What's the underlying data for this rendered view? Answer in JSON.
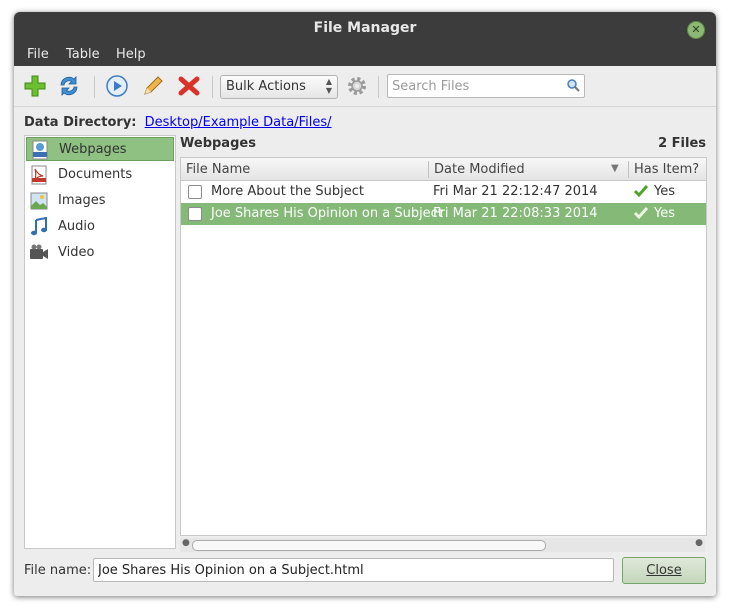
{
  "window": {
    "title": "File Manager"
  },
  "menu": [
    "File",
    "Table",
    "Help"
  ],
  "toolbar": {
    "bulk_actions": "Bulk Actions",
    "search_placeholder": "Search Files"
  },
  "data_directory": {
    "label": "Data Directory:",
    "path": "Desktop/Example Data/Files/"
  },
  "sidebar": {
    "items": [
      {
        "label": "Webpages",
        "icon": "html-file-icon",
        "selected": true
      },
      {
        "label": "Documents",
        "icon": "pdf-file-icon",
        "selected": false
      },
      {
        "label": "Images",
        "icon": "image-file-icon",
        "selected": false
      },
      {
        "label": "Audio",
        "icon": "music-note-icon",
        "selected": false
      },
      {
        "label": "Video",
        "icon": "video-camera-icon",
        "selected": false
      }
    ]
  },
  "main": {
    "heading": "Webpages",
    "count": "2 Files"
  },
  "table": {
    "columns": [
      "File Name",
      "Date Modified",
      "Has Item?"
    ],
    "rows": [
      {
        "name": "More About the Subject",
        "date": "Fri Mar 21 22:12:47 2014",
        "has_item": "Yes",
        "selected": false
      },
      {
        "name": "Joe Shares His Opinion on a Subject",
        "date": "Fri Mar 21 22:08:33 2014",
        "has_item": "Yes",
        "selected": true
      }
    ]
  },
  "footer": {
    "file_name_label": "File name:",
    "file_name_value": "Joe Shares His Opinion on a Subject.html",
    "close_label": "Close"
  },
  "colors": {
    "selection": "#84b977",
    "titlebar": "#3c3c3c",
    "link": "#0000ee"
  }
}
